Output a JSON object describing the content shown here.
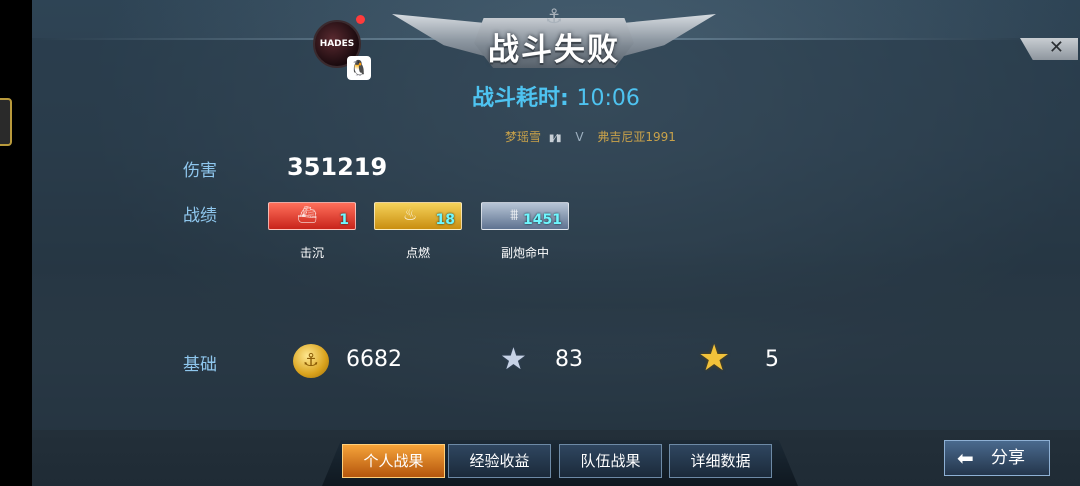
{
  "banner": {
    "title": "战斗失败"
  },
  "duration": {
    "label": "战斗耗时:",
    "time": "10:06"
  },
  "matchup": {
    "player": "梦瑶雪",
    "player_tag": "▮⁄▮",
    "versus": "V",
    "opponent": "弗吉尼亚1991"
  },
  "avatar": {
    "text": "HADES"
  },
  "stats": {
    "damage": {
      "label": "伤害",
      "value": "351219"
    },
    "record": {
      "label": "战绩",
      "medals": [
        {
          "label": "击沉",
          "count": "1",
          "icon": "ship-sink-icon",
          "color": "#e0453a"
        },
        {
          "label": "点燃",
          "count": "18",
          "icon": "fire-icon",
          "color": "#e6b32a"
        },
        {
          "label": "副炮命中",
          "count": "1451",
          "icon": "secondary-gun-icon",
          "color": "#8d9fb8"
        }
      ]
    },
    "base": {
      "label": "基础",
      "coins": "6682",
      "silver_star": "83",
      "gold_star": "5"
    }
  },
  "tabs": [
    {
      "label": "个人战果",
      "active": true
    },
    {
      "label": "经验收益",
      "active": false
    },
    {
      "label": "队伍战果",
      "active": false
    },
    {
      "label": "详细数据",
      "active": false
    }
  ],
  "share": {
    "label": "分享"
  },
  "close": {
    "label": "✕"
  }
}
